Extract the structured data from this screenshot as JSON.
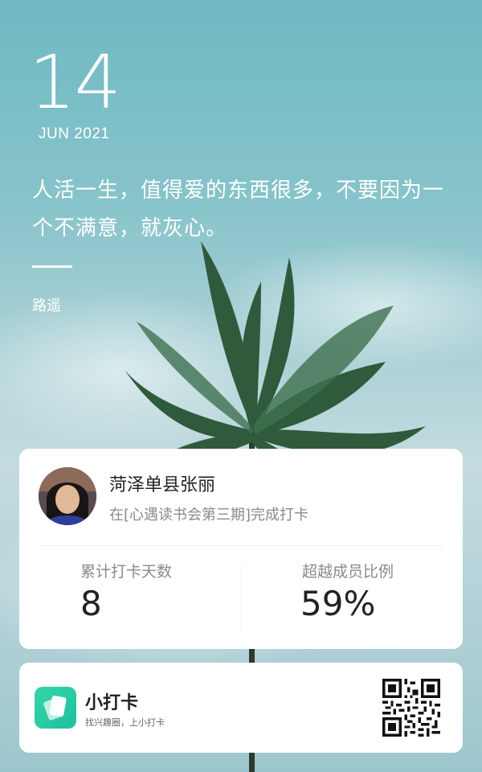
{
  "date": {
    "day": "14",
    "month_year": "JUN 2021"
  },
  "quote": {
    "text": "人活一生，值得爱的东西很多，不要因为一个不满意，就灰心。",
    "author": "路遥"
  },
  "checkin_card": {
    "user_name": "菏泽单县张丽",
    "status": "在[心遇读书会第三期]完成打卡",
    "stats": [
      {
        "label": "累计打卡天数",
        "value": "8"
      },
      {
        "label": "超越成员比例",
        "value": "59%"
      }
    ]
  },
  "app_card": {
    "name": "小打卡",
    "slogan": "找兴趣圈，上小打卡",
    "icon": "app-logo-icon",
    "brand_color": "#2ccfa5"
  }
}
